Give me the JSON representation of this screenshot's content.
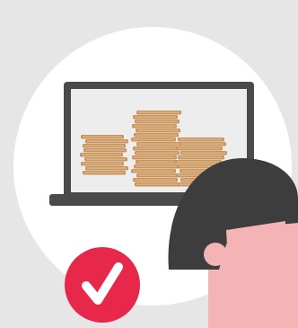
{
  "colors": {
    "background": "#e6e6e6",
    "circle": "#ffffff",
    "laptop_frame": "#4a4a4a",
    "laptop_screen": "#ededed",
    "coin": "#c8935c",
    "coin_stripe": "#e3bd8c",
    "hair": "#3d3d3d",
    "skin": "#f4b4b6",
    "checkmark_badge": "#e8284a",
    "checkmark": "#ffffff"
  },
  "icons": {
    "laptop": "laptop-icon",
    "coins": "coin-stack-icon",
    "person": "person-head-icon",
    "check": "checkmark-icon"
  }
}
